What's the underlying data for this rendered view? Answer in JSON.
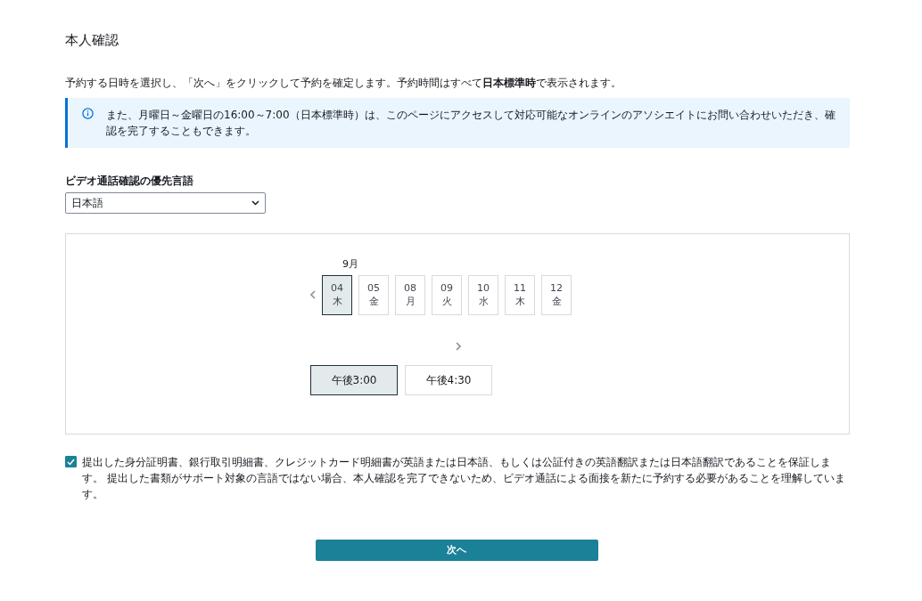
{
  "title": "本人確認",
  "intro": "予約する日時を選択し、「次へ」をクリックして予約を確定します。予約時間はすべて**日本標準時**で表示されます。",
  "info": {
    "text": "また、月曜日～金曜日の16:00～7:00（日本標準時）は、このページにアクセスして対応可能なオンラインのアソシエイトにお問い合わせいただき、確認を完了することもできます。"
  },
  "language": {
    "label": "ビデオ通話確認の優先言語",
    "value": "日本語"
  },
  "calendar": {
    "month": "9月",
    "dates": [
      {
        "day": "04",
        "weekday": "木",
        "selected": true
      },
      {
        "day": "05",
        "weekday": "金",
        "selected": false
      },
      {
        "day": "08",
        "weekday": "月",
        "selected": false
      },
      {
        "day": "09",
        "weekday": "火",
        "selected": false
      },
      {
        "day": "10",
        "weekday": "水",
        "selected": false
      },
      {
        "day": "11",
        "weekday": "木",
        "selected": false
      },
      {
        "day": "12",
        "weekday": "金",
        "selected": false
      }
    ],
    "times": [
      {
        "label": "午後3:00",
        "selected": true
      },
      {
        "label": "午後4:30",
        "selected": false
      }
    ]
  },
  "agreement": {
    "checked": true,
    "text": "提出した身分証明書、銀行取引明細書、クレジットカード明細書が英語または日本語、もしくは公証付きの英語翻訳または日本語翻訳であることを保証します。 提出した書類がサポート対象の言語ではない場合、本人確認を完了できないため、ビデオ通話による面接を新たに予約する必要があることを理解しています。"
  },
  "next_button": "次へ"
}
